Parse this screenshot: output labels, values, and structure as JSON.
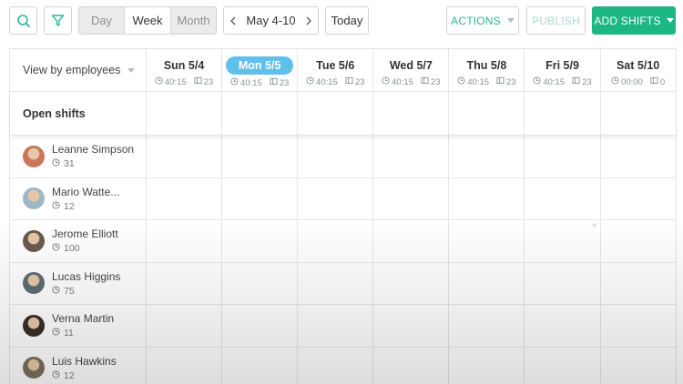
{
  "toolbar": {
    "view_modes": [
      {
        "label": "Day",
        "active": false
      },
      {
        "label": "Week",
        "active": true
      },
      {
        "label": "Month",
        "active": false
      }
    ],
    "date_range": "May 4-10",
    "today_label": "Today",
    "actions_label": "ACTIONS",
    "publish_label": "PUBLISH",
    "add_shifts_label": "ADD SHIFTS"
  },
  "grid": {
    "view_by_label": "View by employees",
    "open_shifts_label": "Open shifts",
    "days": [
      {
        "label": "Sun 5/4",
        "hours": "40:15",
        "count": "23",
        "today": false
      },
      {
        "label": "Mon 5/5",
        "hours": "40:15",
        "count": "23",
        "today": true
      },
      {
        "label": "Tue 5/6",
        "hours": "40:15",
        "count": "23",
        "today": false
      },
      {
        "label": "Wed 5/7",
        "hours": "40:15",
        "count": "23",
        "today": false
      },
      {
        "label": "Thu 5/8",
        "hours": "40:15",
        "count": "23",
        "today": false
      },
      {
        "label": "Fri 5/9",
        "hours": "40:15",
        "count": "23",
        "today": false
      },
      {
        "label": "Sat 5/10",
        "hours": "00:00",
        "count": "0",
        "today": false
      }
    ],
    "employees": [
      {
        "name": "Leanne Simpson",
        "hours": "31"
      },
      {
        "name": "Mario Watte...",
        "hours": "12"
      },
      {
        "name": "Jerome Elliott",
        "hours": "100"
      },
      {
        "name": "Lucas Higgins",
        "hours": "75"
      },
      {
        "name": "Verna Martin",
        "hours": "11"
      },
      {
        "name": "Luis Hawkins",
        "hours": "12"
      }
    ],
    "close_marker": "×"
  },
  "colors": {
    "accent": "#1cb785",
    "actions_text": "#2fb5a0",
    "publish_text": "#a8d9cf",
    "today_pill": "#5fc0ec"
  },
  "icons": [
    "search-icon",
    "filter-icon",
    "chevron-left-icon",
    "chevron-right-icon",
    "caret-down-icon",
    "clock-icon",
    "shifts-count-icon",
    "close-icon"
  ]
}
